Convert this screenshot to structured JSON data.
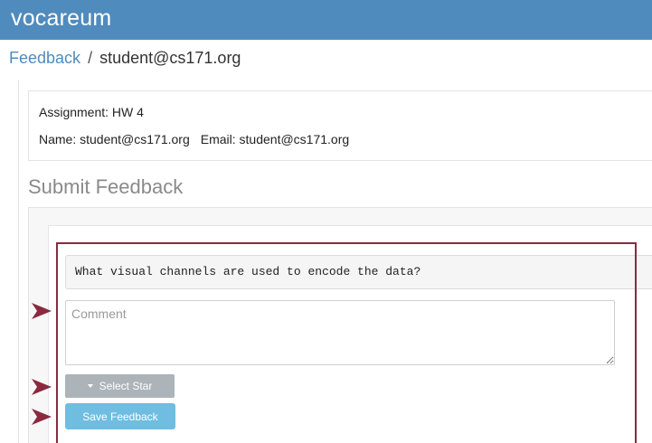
{
  "header": {
    "brand": "vocareum",
    "bg_color": "#4f8bbd"
  },
  "breadcrumb": {
    "link": "Feedback",
    "separator": "/",
    "current": "student@cs171.org"
  },
  "info": {
    "assignment": "Assignment: HW 4",
    "name": "Name: student@cs171.org",
    "email": "Email: student@cs171.org"
  },
  "section": {
    "title": "Submit Feedback"
  },
  "feedback": {
    "question": "What visual channels are used to encode the data?",
    "comment_placeholder": "Comment",
    "comment_value": "",
    "star_label": "Select Star",
    "save_label": "Save Feedback",
    "highlight_color": "#8a2a3f",
    "star_button_color": "#acb3b9",
    "save_button_color": "#6fbde0"
  },
  "annotations": {
    "arrow_icon": "arrow-right-icon",
    "arrow_color": "#8a2a3f"
  }
}
